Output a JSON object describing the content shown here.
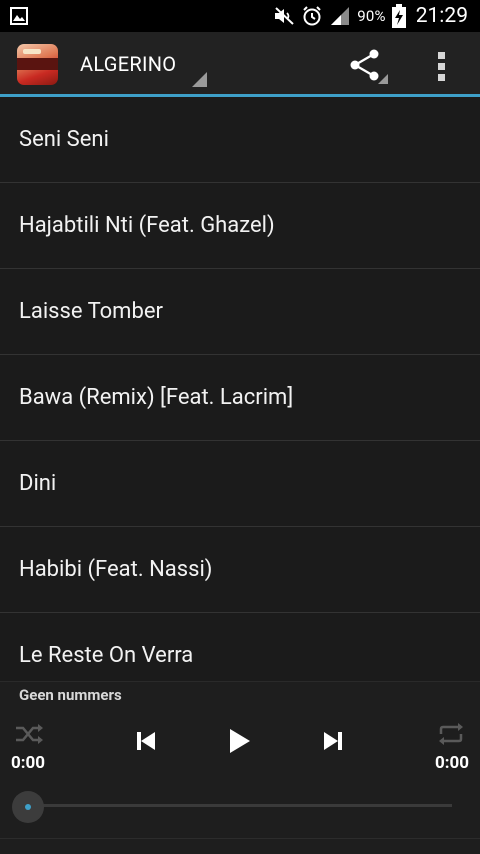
{
  "status_bar": {
    "battery_percent": "90%",
    "time": "21:29",
    "icons": [
      "image-notification-icon",
      "mute-icon",
      "alarm-icon",
      "signal-icon",
      "battery-charging-icon"
    ]
  },
  "action_bar": {
    "title": "ALGERINO",
    "icons": [
      "app-icon",
      "share-icon",
      "overflow-menu-icon"
    ]
  },
  "tracks": [
    "Seni Seni",
    "Hajabtili Nti (Feat. Ghazel)",
    "Laisse Tomber",
    "Bawa (Remix) [Feat. Lacrim]",
    "Dini",
    "Habibi (Feat. Nassi)",
    "Le Reste On Verra"
  ],
  "player": {
    "status_text": "Geen nummers",
    "elapsed": "0:00",
    "duration": "0:00",
    "progress": 0,
    "controls": [
      "shuffle-icon",
      "previous-icon",
      "play-icon",
      "next-icon",
      "repeat-icon"
    ],
    "accent_color": "#3ea0c9"
  }
}
